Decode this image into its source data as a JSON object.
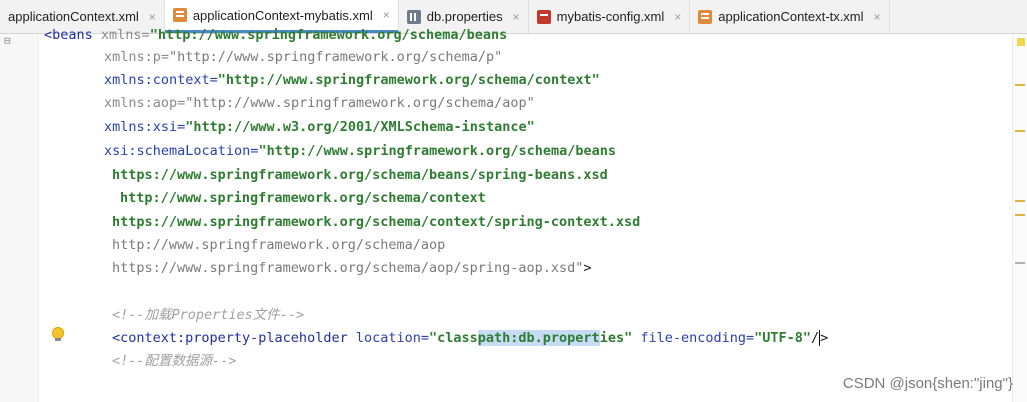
{
  "tabs": [
    {
      "label": "applicationContext.xml",
      "icon": "xml-file-icon"
    },
    {
      "label": "applicationContext-mybatis.xml",
      "icon": "xml-file-icon",
      "active": true
    },
    {
      "label": "db.properties",
      "icon": "properties-file-icon"
    },
    {
      "label": "mybatis-config.xml",
      "icon": "mybatis-file-icon"
    },
    {
      "label": "applicationContext-tx.xml",
      "icon": "xml-file-icon"
    }
  ],
  "close_glyph": "×",
  "code": {
    "l0_tag": "<beans",
    "l0_attr": " xmlns=",
    "l0_val": "\"http://www.springframework.org/schema/beans",
    "l1_attr": "xmlns:p=",
    "l1_val": "\"http://www.springframework.org/schema/p\"",
    "l2_attr": "xmlns:context=",
    "l2_val": "\"http://www.springframework.org/schema/context\"",
    "l3_attr": "xmlns:aop=",
    "l3_val": "\"http://www.springframework.org/schema/aop\"",
    "l4_attr": "xmlns:xsi=",
    "l4_val": "\"http://www.w3.org/2001/XMLSchema-instance\"",
    "l5_attr": "xsi:schemaLocation=",
    "l5_val": "\"http://www.springframework.org/schema/beans",
    "l6": "https://www.springframework.org/schema/beans/spring-beans.xsd",
    "l7": "http://www.springframework.org/schema/context",
    "l8": "https://www.springframework.org/schema/context/spring-context.xsd",
    "l9": "http://www.springframework.org/schema/aop",
    "l10_val": "https://www.springframework.org/schema/aop/spring-aop.xsd\"",
    "l10_end": ">",
    "c1": "<!--加载Properties文件-->",
    "l12_tag": "<context:property-placeholder",
    "l12_attr1": " location=",
    "l12_v1a": "\"class",
    "l12_v1hl": "path:",
    "l12_v1b": "db.propert",
    "l12_v1c": "ies\"",
    "l12_attr2": " file-encoding=",
    "l12_v2": "\"UTF-8\"",
    "l12_end1": "/",
    "l12_end2": ">",
    "c2": "<!--配置数据源-->"
  },
  "watermark": "CSDN @json{shen:\"jing\"}",
  "colors": {
    "active_tab_underline": "#4a88c7",
    "string": "#2f7d32",
    "attribute": "#2a3fb0"
  }
}
